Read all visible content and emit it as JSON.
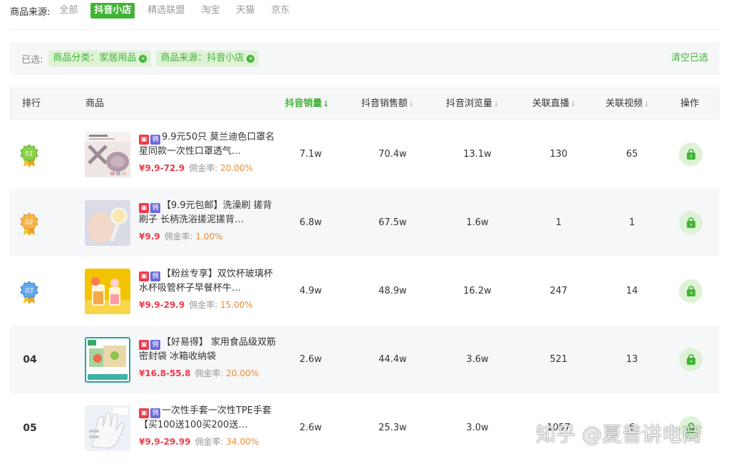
{
  "source_filter": {
    "label": "商品来源:",
    "options": [
      "全部",
      "抖音小店",
      "精选联盟",
      "淘宝",
      "天猫",
      "京东"
    ],
    "active": "抖音小店"
  },
  "selected": {
    "label": "已选:",
    "tags": [
      "商品分类：家居用品",
      "商品来源：抖音小店"
    ],
    "clear_label": "清空已选"
  },
  "table": {
    "headers": {
      "rank": "排行",
      "product": "商品",
      "sales": "抖音销量",
      "revenue": "抖音销售额",
      "views": "抖音浏览量",
      "live": "关联直播",
      "video": "关联视频",
      "action": "操作"
    },
    "active_sort": "抖音销量",
    "accent_color": "#41b336",
    "price_color": "#ee3b4b",
    "rate_color": "#f08a2b",
    "rows": [
      {
        "rank": "01",
        "medal": "green",
        "title": "9.9元50只 莫兰迪色口罩名星同款一次性口罩透气…",
        "price": "¥9.9-72.9",
        "rate_label": "佣金率:",
        "rate": "20.00%",
        "sales": "7.1w",
        "revenue": "70.4w",
        "views": "13.1w",
        "live": "130",
        "video": "65"
      },
      {
        "rank": "02",
        "medal": "orange",
        "title": "【9.9元包邮】洗澡刷 搓背刷子 长柄洗浴搓泥搓背…",
        "price": "¥9.9",
        "rate_label": "佣金率:",
        "rate": "1.00%",
        "sales": "6.8w",
        "revenue": "67.5w",
        "views": "1.6w",
        "live": "1",
        "video": "1"
      },
      {
        "rank": "03",
        "medal": "blue",
        "title": "【粉丝专享】双饮杯玻璃杯水杯吸管杯子早餐杯牛…",
        "price": "¥9.9-29.9",
        "rate_label": "佣金率:",
        "rate": "15.00%",
        "sales": "4.9w",
        "revenue": "48.9w",
        "views": "16.2w",
        "live": "247",
        "video": "14"
      },
      {
        "rank": "04",
        "medal": "",
        "title": "【好易得】 家用食品级双筋密封袋 冰箱收纳袋",
        "price": "¥16.8-55.8",
        "rate_label": "佣金率:",
        "rate": "20.00%",
        "sales": "2.6w",
        "revenue": "44.4w",
        "views": "3.6w",
        "live": "521",
        "video": "13"
      },
      {
        "rank": "05",
        "medal": "",
        "title": "一次性手套一次性TPE手套【买100送100买200送…",
        "price": "¥9.9-29.99",
        "rate_label": "佣金率:",
        "rate": "34.00%",
        "sales": "2.6w",
        "revenue": "25.3w",
        "views": "3.0w",
        "live": "1057",
        "video": "6"
      }
    ]
  },
  "badges": {
    "shop": "shop-icon",
    "commission": "佣"
  },
  "watermark": "知乎 @夏普讲电商"
}
